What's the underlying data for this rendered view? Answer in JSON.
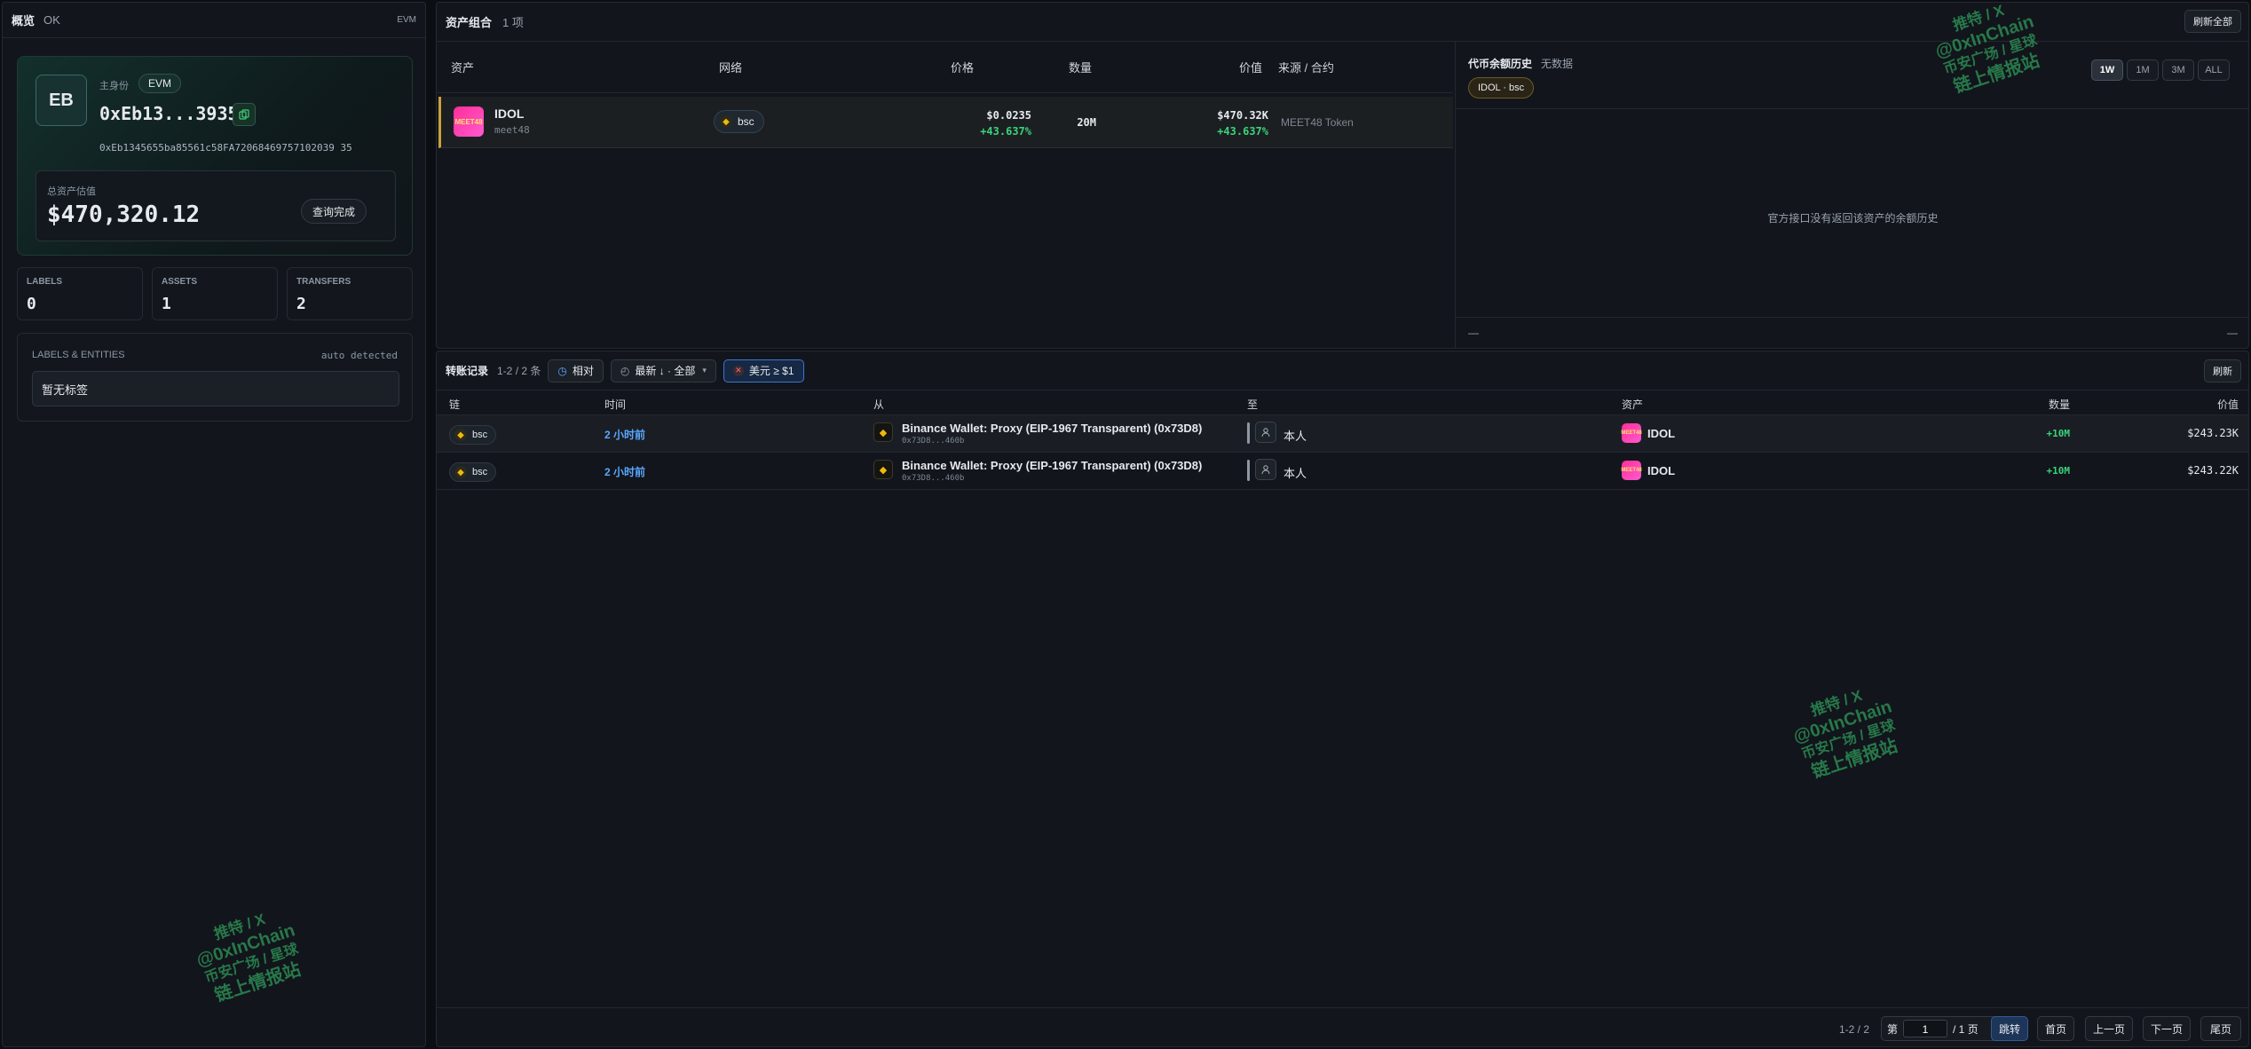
{
  "left": {
    "title": "概览",
    "status": "OK",
    "chain": "EVM",
    "wallet": {
      "avatar": "EB",
      "role": "主身份",
      "chip": "EVM",
      "short_address": "0xEb13...3935",
      "full_address": "0xEb1345655ba85561c58FA72068469757102039 35",
      "total_label": "总资产估值",
      "total_value": "$470,320.12",
      "query_button": "查询完成"
    },
    "stats": [
      {
        "label": "LABELS",
        "value": "0"
      },
      {
        "label": "ASSETS",
        "value": "1"
      },
      {
        "label": "TRANSFERS",
        "value": "2"
      }
    ],
    "entities": {
      "title": "LABELS & ENTITIES",
      "auto": "auto detected",
      "empty": "暂无标签"
    }
  },
  "watermark": {
    "line1": "推特 / X",
    "line2": "@0xInChain",
    "line3": "币安广场 / 星球",
    "line4": "链上情报站"
  },
  "portfolio": {
    "title": "资产组合",
    "count": "1 项",
    "refresh_all": "刷新全部",
    "headers": {
      "asset": "资产",
      "network": "网络",
      "price": "价格",
      "qty": "数量",
      "value": "价值",
      "source": "来源 / 合约"
    },
    "row": {
      "icon_text": "MEET48",
      "name": "IDOL",
      "sub": "meet48",
      "network": "bsc",
      "price": "$0.0235",
      "price_change": "+43.637%",
      "qty": "20M",
      "value": "$470.32K",
      "value_change": "+43.637%",
      "source": "MEET48 Token"
    }
  },
  "history": {
    "title": "代币余额历史",
    "nodata": "无数据",
    "chip": "IDOL · bsc",
    "ranges": [
      "1W",
      "1M",
      "3M",
      "ALL"
    ],
    "active_range": "1W",
    "empty": "官方接口没有返回该资产的余额历史",
    "foot_left": "—",
    "foot_right": "—"
  },
  "transfers": {
    "title": "转账记录",
    "count": "1-2 / 2 条",
    "filter_relative": "相对",
    "filter_sort": "最新 ↓ · 全部",
    "filter_usd": "美元 ≥ $1",
    "refresh": "刷新",
    "headers": {
      "chain": "链",
      "time": "时间",
      "from": "从",
      "to": "至",
      "asset": "资产",
      "qty": "数量",
      "value": "价值"
    },
    "rows": [
      {
        "chain": "bsc",
        "time": "2 小时前",
        "from_name": "Binance Wallet: Proxy (EIP-1967 Transparent) (0x73D8)",
        "from_addr": "0x73D8...460b",
        "to": "本人",
        "asset_icon": "MEET48",
        "asset": "IDOL",
        "qty": "+10M",
        "value": "$243.23K"
      },
      {
        "chain": "bsc",
        "time": "2 小时前",
        "from_name": "Binance Wallet: Proxy (EIP-1967 Transparent) (0x73D8)",
        "from_addr": "0x73D8...460b",
        "to": "本人",
        "asset_icon": "MEET48",
        "asset": "IDOL",
        "qty": "+10M",
        "value": "$243.22K"
      }
    ],
    "pager": {
      "info": "1-2 / 2",
      "page_prefix": "第",
      "page_value": "1",
      "page_suffix": "/ 1 页",
      "jump": "跳转",
      "first": "首页",
      "prev": "上一页",
      "next": "下一页",
      "last": "尾页"
    }
  },
  "colors": {
    "accent_green": "#39d37a",
    "link_blue": "#5aa7ff",
    "bsc_yellow": "#f0b90b",
    "token_pink": "#ff2e97"
  }
}
